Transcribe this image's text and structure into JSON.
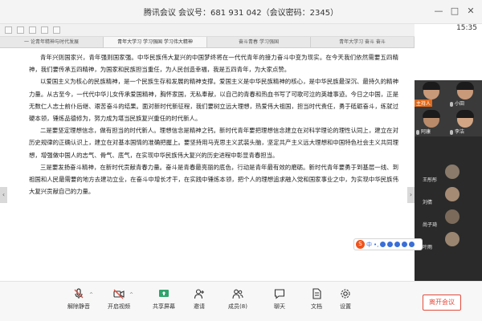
{
  "window": {
    "title": "腾讯会议 会议号：681 931 042（会议密码：2345）",
    "buttons": [
      "—",
      "□",
      "✕"
    ]
  },
  "timer": "15:35",
  "document": {
    "tabs": [
      "一 论青年精神与时代发展",
      "青年大学习 学习强国 学习伟大精神",
      "奋斗青春 学习强国",
      "青年大学习 奋斗 奋斗"
    ],
    "paragraphs": [
      "青年兴则国家兴，青年强则国家强。中华民族伟大复兴的中国梦终将在一代代青年的接力奋斗中变为现实。在今天我们依然需要五四精神，我们要传承五四精神，为国家和民族担当重任，为人民创造幸福，我是五四青年，为大家点赞。",
      "以爱国主义为核心的民族精神，是一个民族生存和发展的精神支撑。爱国主义是中华民族精神的核心，是中华民族最深沉、最持久的精神力量。从古至今，一代代中华儿女传承爱国精神，胸怀家国，无私奉献，以自己的青春和热血书写了可歌可泣的英雄事迹。今日之中国，正是无数仁人志士前仆后继、艰苦奋斗的结果。面对新时代新征程，我们要树立远大理想，热爱伟大祖国，担当时代责任，勇于砥砺奋斗，练就过硬本领，锤炼品德修为，努力成为堪当民族复兴重任的时代新人。",
      "二是要坚定理想信念，做有担当的时代新人。理想信念是精神之钙。新时代青年要把理想信念建立在对科学理论的理性认同上，建立在对历史规律的正确认识上，建立在对基本国情的准确把握上。要坚持用马克思主义武装头脑，坚定共产主义远大理想和中国特色社会主义共同理想，增强做中国人的志气、骨气、底气，在实现中华民族伟大复兴的历史进程中彰显青春担当。",
      "三是要发扬奋斗精神，在新时代贡献青春力量。奋斗是青春最亮丽的底色，行动是青年最有效的磨砺。新时代青年要勇于到基层一线、到祖国和人民最需要的地方去建功立业，在奋斗中增长才干，在实践中锤炼本领，把个人的理想追求融入党和国家事业之中，为实现中华民族伟大复兴贡献自己的力量。"
    ]
  },
  "participants": {
    "tiles": [
      {
        "name": "主持人"
      },
      {
        "name": "小田"
      },
      {
        "name": "阿康"
      },
      {
        "name": "李洁"
      }
    ],
    "rows": [
      {
        "name": "王彤彤"
      },
      {
        "name": "刘倩"
      },
      {
        "name": "尚子琦"
      },
      {
        "name": "叶雨"
      }
    ]
  },
  "ime": {
    "label": "中",
    "punct": "•,"
  },
  "toolbar": {
    "tools": [
      {
        "label": "解除静音",
        "icon": "mic-icon"
      },
      {
        "label": "开启视频",
        "icon": "camera-icon"
      },
      {
        "label": "共享屏幕",
        "icon": "share-screen-icon"
      },
      {
        "label": "邀请",
        "icon": "invite-icon"
      },
      {
        "label": "成员(8)",
        "icon": "members-icon"
      },
      {
        "label": "聊天",
        "icon": "chat-icon"
      },
      {
        "label": "文档",
        "icon": "document-icon"
      },
      {
        "label": "设置",
        "icon": "settings-icon"
      }
    ],
    "leave_label": "离开会议"
  },
  "colors": {
    "accent": "#e24a3b",
    "host_badge": "#e06a1b",
    "share_active": "#2fa36b"
  }
}
